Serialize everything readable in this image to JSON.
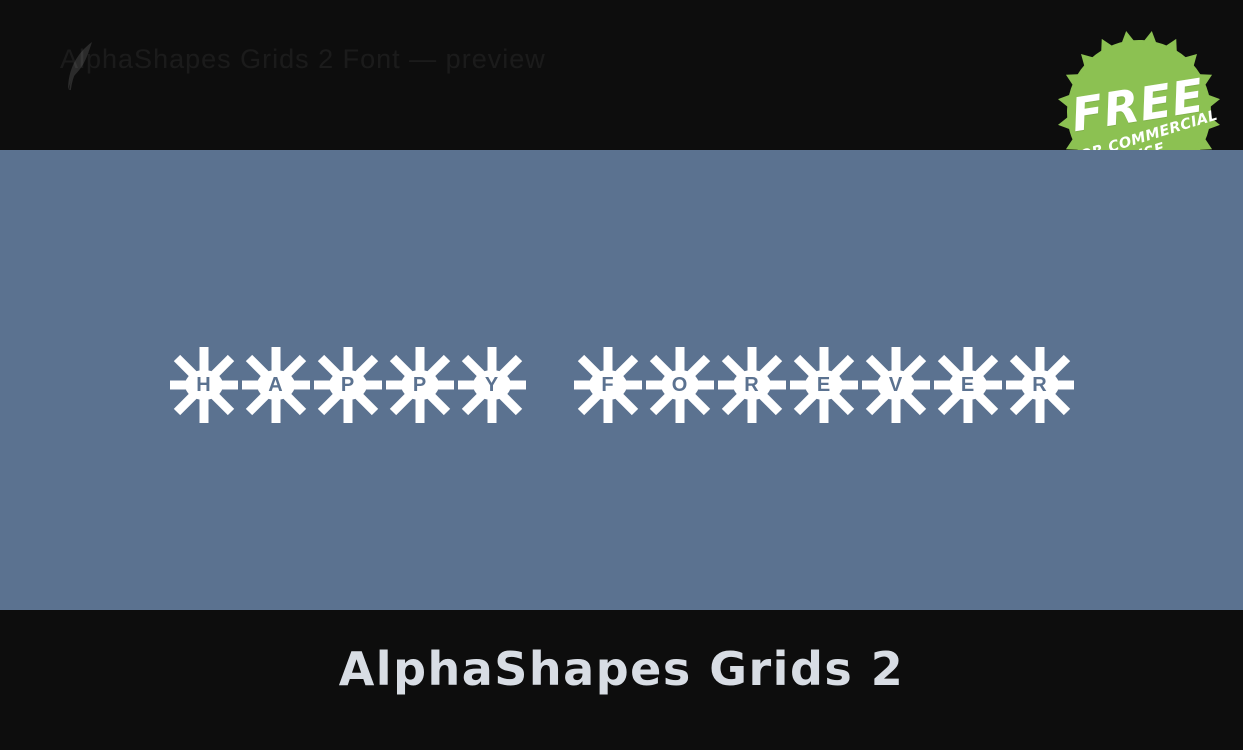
{
  "topbar": {
    "watermark_text": "AlphaShapes Grids 2 Font — preview",
    "logo_icon": "leaf-logo-icon"
  },
  "badge": {
    "primary_label": "FREE",
    "secondary_label": "FOR COMMERCIAL USE",
    "color": "#8cc152",
    "text_color": "#ffffff"
  },
  "preview": {
    "background_color": "#5b7290",
    "sample_text": "HAPPY FOREVER",
    "glyphs": [
      {
        "char": "H",
        "type": "snowflake-tile"
      },
      {
        "char": "A",
        "type": "snowflake-tile"
      },
      {
        "char": "P",
        "type": "snowflake-tile"
      },
      {
        "char": "P",
        "type": "snowflake-tile"
      },
      {
        "char": "Y",
        "type": "snowflake-tile"
      },
      {
        "char": " ",
        "type": "space"
      },
      {
        "char": "F",
        "type": "snowflake-tile"
      },
      {
        "char": "O",
        "type": "snowflake-tile"
      },
      {
        "char": "R",
        "type": "snowflake-tile"
      },
      {
        "char": "E",
        "type": "snowflake-tile"
      },
      {
        "char": "V",
        "type": "snowflake-tile"
      },
      {
        "char": "E",
        "type": "snowflake-tile"
      },
      {
        "char": "R",
        "type": "snowflake-tile"
      }
    ]
  },
  "footer": {
    "font_name": "AlphaShapes Grids 2",
    "background_color": "#0d0d0d",
    "text_color": "#d8dde4"
  }
}
